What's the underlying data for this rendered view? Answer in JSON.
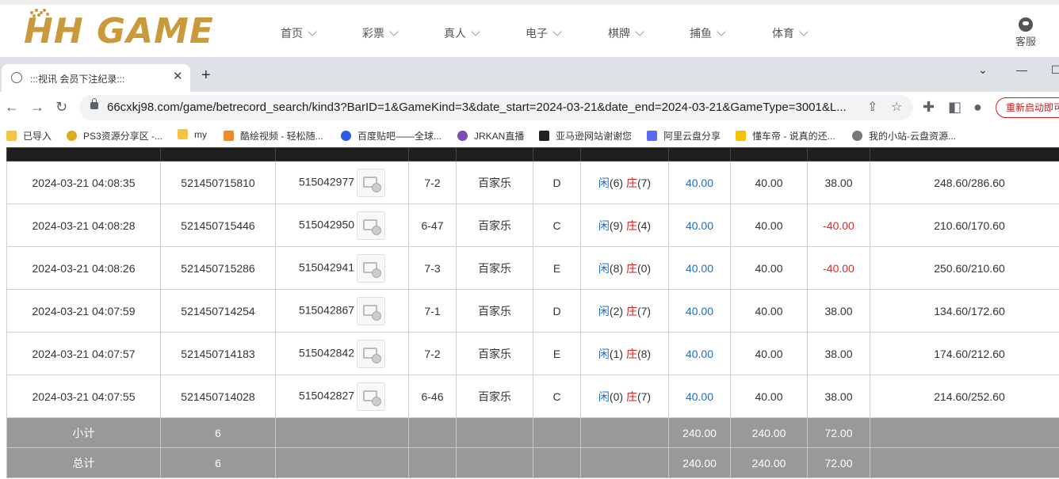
{
  "site": {
    "logo_text": "HH GAME",
    "nav": [
      "首页",
      "彩票",
      "真人",
      "电子",
      "棋牌",
      "捕鱼",
      "体育"
    ],
    "customer_service": "客服"
  },
  "browser": {
    "tab_title": ":::视讯 会员下注纪录:::",
    "url": "66cxkj98.com/game/betrecord_search/kind3?BarID=1&GameKind=3&date_start=2024-03-21&date_end=2024-03-21&GameType=3001&L...",
    "restart_label": "重新启动即可",
    "bookmarks": [
      "已导入",
      "PS3资源分享区 -...",
      "my",
      "酷绘视频 - 轻松随...",
      "百度贴吧——全球...",
      "JRKAN直播",
      "亚马逊网站谢谢您",
      "阿里云盘分享",
      "懂车帝 - 说真的还...",
      "我的小站-云盘资源..."
    ]
  },
  "table": {
    "rows": [
      {
        "time": "2024-03-21 04:08:35",
        "order": "521450715810",
        "game_no": "515042977",
        "round": "7-2",
        "game": "百家乐",
        "table": "D",
        "xian_label": "闲",
        "xian": "(6)",
        "zhuang_label": "庄",
        "zhuang": "(7)",
        "bet": "40.00",
        "valid": "40.00",
        "win": "38.00",
        "balance": "248.60/286.60",
        "win_color": "normal"
      },
      {
        "time": "2024-03-21 04:08:28",
        "order": "521450715446",
        "game_no": "515042950",
        "round": "6-47",
        "game": "百家乐",
        "table": "C",
        "xian_label": "闲",
        "xian": "(9)",
        "zhuang_label": "庄",
        "zhuang": "(4)",
        "bet": "40.00",
        "valid": "40.00",
        "win": "-40.00",
        "balance": "210.60/170.60",
        "win_color": "red"
      },
      {
        "time": "2024-03-21 04:08:26",
        "order": "521450715286",
        "game_no": "515042941",
        "round": "7-3",
        "game": "百家乐",
        "table": "E",
        "xian_label": "闲",
        "xian": "(8)",
        "zhuang_label": "庄",
        "zhuang": "(0)",
        "bet": "40.00",
        "valid": "40.00",
        "win": "-40.00",
        "balance": "250.60/210.60",
        "win_color": "red"
      },
      {
        "time": "2024-03-21 04:07:59",
        "order": "521450714254",
        "game_no": "515042867",
        "round": "7-1",
        "game": "百家乐",
        "table": "D",
        "xian_label": "闲",
        "xian": "(2)",
        "zhuang_label": "庄",
        "zhuang": "(7)",
        "bet": "40.00",
        "valid": "40.00",
        "win": "38.00",
        "balance": "134.60/172.60",
        "win_color": "normal"
      },
      {
        "time": "2024-03-21 04:07:57",
        "order": "521450714183",
        "game_no": "515042842",
        "round": "7-2",
        "game": "百家乐",
        "table": "E",
        "xian_label": "闲",
        "xian": "(1)",
        "zhuang_label": "庄",
        "zhuang": "(8)",
        "bet": "40.00",
        "valid": "40.00",
        "win": "38.00",
        "balance": "174.60/212.60",
        "win_color": "normal"
      },
      {
        "time": "2024-03-21 04:07:55",
        "order": "521450714028",
        "game_no": "515042827",
        "round": "6-46",
        "game": "百家乐",
        "table": "C",
        "xian_label": "闲",
        "xian": "(0)",
        "zhuang_label": "庄",
        "zhuang": "(7)",
        "bet": "40.00",
        "valid": "40.00",
        "win": "38.00",
        "balance": "214.60/252.60",
        "win_color": "normal"
      }
    ],
    "subtotal": {
      "label": "小计",
      "count": "6",
      "bet": "240.00",
      "valid": "240.00",
      "win": "72.00"
    },
    "total": {
      "label": "总计",
      "count": "6",
      "bet": "240.00",
      "valid": "240.00",
      "win": "72.00"
    }
  },
  "colors": {
    "logo_gold": "#c99a3c",
    "sum_row_bg": "#999999",
    "header_bg": "#1e1e1e",
    "blue_text": "#1a6fcc",
    "red_text": "#e12727"
  }
}
